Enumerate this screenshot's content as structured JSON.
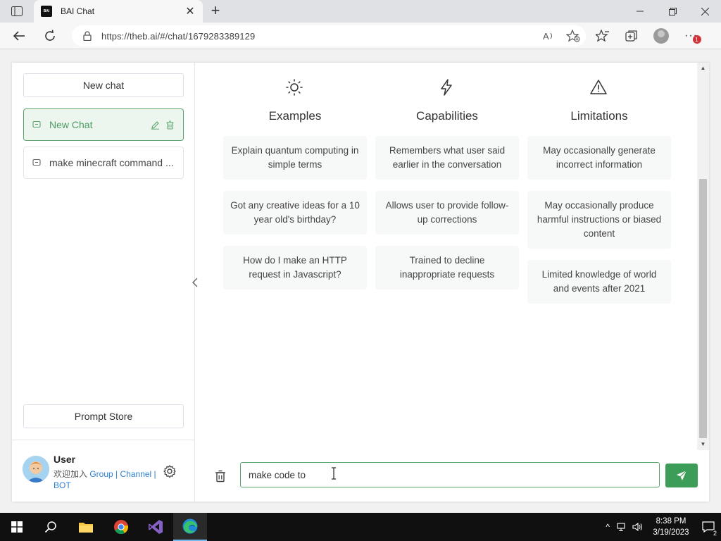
{
  "browser": {
    "tab_title": "BAI Chat",
    "favicon_text": "BAI",
    "url": "https://theb.ai/#/chat/1679283389129",
    "notification_count": "1"
  },
  "sidebar": {
    "new_chat_label": "New chat",
    "chats": [
      {
        "label": "New Chat",
        "active": true
      },
      {
        "label": "make minecraft command ..."
      }
    ],
    "prompt_store_label": "Prompt Store",
    "user": {
      "name": "User",
      "prefix": "欢迎加入 ",
      "link_group": "Group",
      "link_channel": "Channel",
      "link_bot": "BOT",
      "separator": " | "
    }
  },
  "main": {
    "columns": [
      {
        "icon": "sun-icon",
        "title": "Examples",
        "cards": [
          "Explain quantum computing in simple terms",
          "Got any creative ideas for a 10 year old's birthday?",
          "How do I make an HTTP request in Javascript?"
        ]
      },
      {
        "icon": "lightning-icon",
        "title": "Capabilities",
        "cards": [
          "Remembers what user said earlier in the conversation",
          "Allows user to provide follow-up corrections",
          "Trained to decline inappropriate requests"
        ]
      },
      {
        "icon": "warning-icon",
        "title": "Limitations",
        "cards": [
          "May occasionally generate incorrect information",
          "May occasionally produce harmful instructions or biased content",
          "Limited knowledge of world and events after 2021"
        ]
      }
    ]
  },
  "composer": {
    "input_value": "make code to"
  },
  "taskbar": {
    "time": "8:38 PM",
    "date": "3/19/2023",
    "notification_count": "2"
  },
  "colors": {
    "accent": "#3b9d57",
    "active_chat_bg": "#ecf5ee",
    "link": "#2d7fd3"
  }
}
